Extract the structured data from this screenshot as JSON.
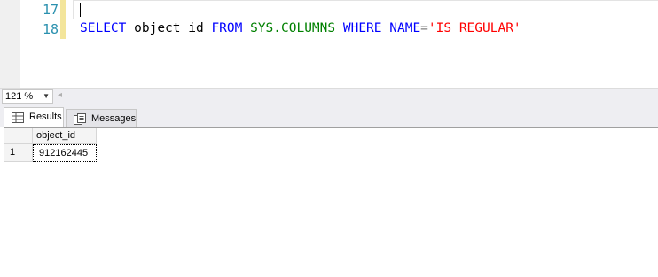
{
  "editor": {
    "line_numbers": [
      "17",
      "18"
    ],
    "sql": {
      "select": "SELECT",
      "column": "object_id",
      "from": "FROM",
      "schema": "SYS.COLUMNS",
      "where": "WHERE",
      "name": "NAME",
      "eq": "=",
      "value": "'IS_REGULAR'"
    }
  },
  "zoom": {
    "value": "121 %"
  },
  "tabs": {
    "results": "Results",
    "messages": "Messages"
  },
  "grid": {
    "columns": [
      "object_id"
    ],
    "rows": [
      {
        "num": "1",
        "values": [
          "912162445"
        ]
      }
    ]
  },
  "colors": {
    "keyword": "#0000ff",
    "system": "#008000",
    "string": "#ff0000",
    "line_number": "#2b91af"
  }
}
